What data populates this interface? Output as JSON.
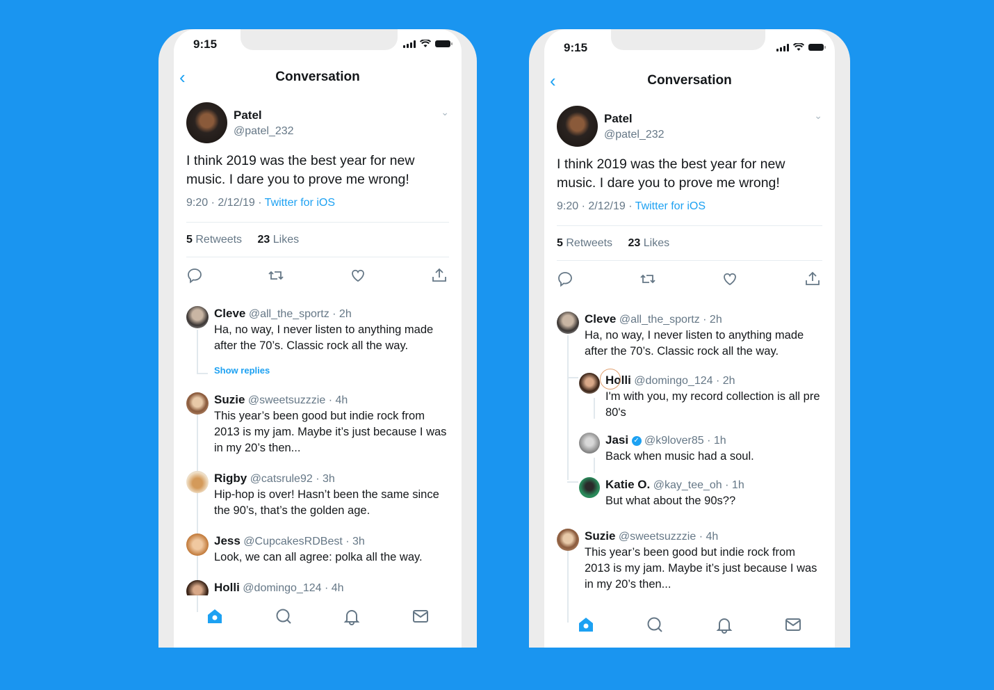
{
  "background_color": "#1a95f0",
  "accent_color": "#1da1f2",
  "phones": [
    {
      "status_time": "9:15",
      "nav_title": "Conversation",
      "main_tweet": {
        "name": "Patel",
        "handle": "@patel_232",
        "text": "I think 2019 was the best year for new music. I dare you to prove me wrong!",
        "time_date": "9:20 · 2/12/19 · ",
        "source": "Twitter for iOS",
        "retweets_count": "5",
        "retweets_label": "Retweets",
        "likes_count": "23",
        "likes_label": "Likes"
      },
      "replies": [
        {
          "name": "Cleve",
          "handle": "@all_the_sportz",
          "time": "· 2h",
          "text": "Ha, no way, I never listen to anything made after the 70’s. Classic rock all the way.",
          "show_replies": "Show replies"
        },
        {
          "name": "Suzie",
          "handle": "@sweetsuzzzie",
          "time": "· 4h",
          "text": "This year’s been good but indie rock from 2013 is my jam. Maybe it’s just because I was in my 20’s then..."
        },
        {
          "name": "Rigby",
          "handle": "@catsrule92",
          "time": "· 3h",
          "text": "Hip-hop is over! Hasn’t been the same since the 90’s, that’s the golden age."
        },
        {
          "name": "Jess",
          "handle": "@CupcakesRDBest",
          "time": "· 3h",
          "text": "Look, we can all agree: polka all the way."
        },
        {
          "name": "Holli",
          "handle": "@domingo_124",
          "time": "· 4h",
          "text": ""
        }
      ],
      "tabbar": [
        "home-icon",
        "search-icon",
        "notifications-icon",
        "messages-icon"
      ]
    },
    {
      "status_time": "9:15",
      "nav_title": "Conversation",
      "main_tweet": {
        "name": "Patel",
        "handle": "@patel_232",
        "text": "I think 2019 was the best year for new music. I dare you to prove me wrong!",
        "time_date": "9:20 · 2/12/19 · ",
        "source": "Twitter for iOS",
        "retweets_count": "5",
        "retweets_label": "Retweets",
        "likes_count": "23",
        "likes_label": "Likes"
      },
      "replies": [
        {
          "name": "Cleve",
          "handle": "@all_the_sportz",
          "time": "· 2h",
          "text": "Ha, no way, I never listen to anything made after the 70’s. Classic rock all the way."
        },
        {
          "name": "Holli",
          "handle": "@domingo_124",
          "time": "· 2h",
          "text": "I'm with you, my record collection is all pre 80's",
          "nested": true
        },
        {
          "name": "Jasi",
          "handle": "@k9lover85",
          "time": "· 1h",
          "text": "Back when music had a soul.",
          "nested": true,
          "verified": true
        },
        {
          "name": "Katie O.",
          "handle": "@kay_tee_oh",
          "time": "· 1h",
          "text": "But what about the 90s??",
          "nested": true
        },
        {
          "name": "Suzie",
          "handle": "@sweetsuzzzie",
          "time": "· 4h",
          "text": "This year’s been good but indie rock from 2013 is my jam. Maybe it’s just because I was in my 20’s then..."
        }
      ],
      "tabbar": [
        "home-icon",
        "search-icon",
        "notifications-icon",
        "messages-icon"
      ]
    }
  ]
}
